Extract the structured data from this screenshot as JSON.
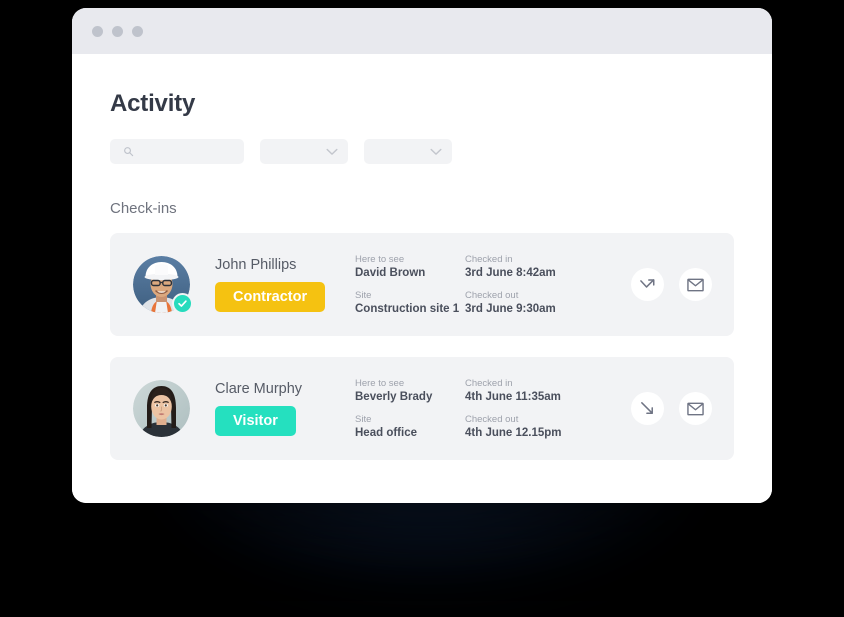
{
  "window": {
    "traffic_lights": [
      "dot-1",
      "dot-2",
      "dot-3"
    ]
  },
  "header": {
    "title": "Activity"
  },
  "filters": {
    "search": {
      "icon": "search-icon",
      "value": "",
      "placeholder": ""
    },
    "dropdowns": [
      {
        "icon": "chevron-down-icon",
        "value": ""
      },
      {
        "icon": "chevron-down-icon",
        "value": ""
      }
    ]
  },
  "section": {
    "title": "Check-ins"
  },
  "colors": {
    "contractor_badge": "#F5C211",
    "visitor_badge": "#25E0BF",
    "verified_badge": "#27DBBD",
    "card_bg": "#F2F3F5",
    "heading": "#343A47"
  },
  "labels": {
    "here_to_see": "Here to see",
    "site": "Site",
    "checked_in": "Checked in",
    "checked_out": "Checked out"
  },
  "checkins": [
    {
      "name": "John Phillips",
      "role": "Contractor",
      "role_color": "#F5C211",
      "avatar": "avatar-hardhat-man",
      "verified": true,
      "here_to_see": "David Brown",
      "site": "Construction site 1",
      "checked_in": "3rd June 8:42am",
      "checked_out": "3rd June 9:30am",
      "status_icon": "check-out-arrow-icon",
      "message_icon": "envelope-icon"
    },
    {
      "name": "Clare Murphy",
      "role": "Visitor",
      "role_color": "#25E0BF",
      "avatar": "avatar-woman",
      "verified": false,
      "here_to_see": "Beverly Brady",
      "site": "Head office",
      "checked_in": "4th June 11:35am",
      "checked_out": "4th June 12.15pm",
      "status_icon": "check-in-arrow-icon",
      "message_icon": "envelope-icon"
    }
  ]
}
